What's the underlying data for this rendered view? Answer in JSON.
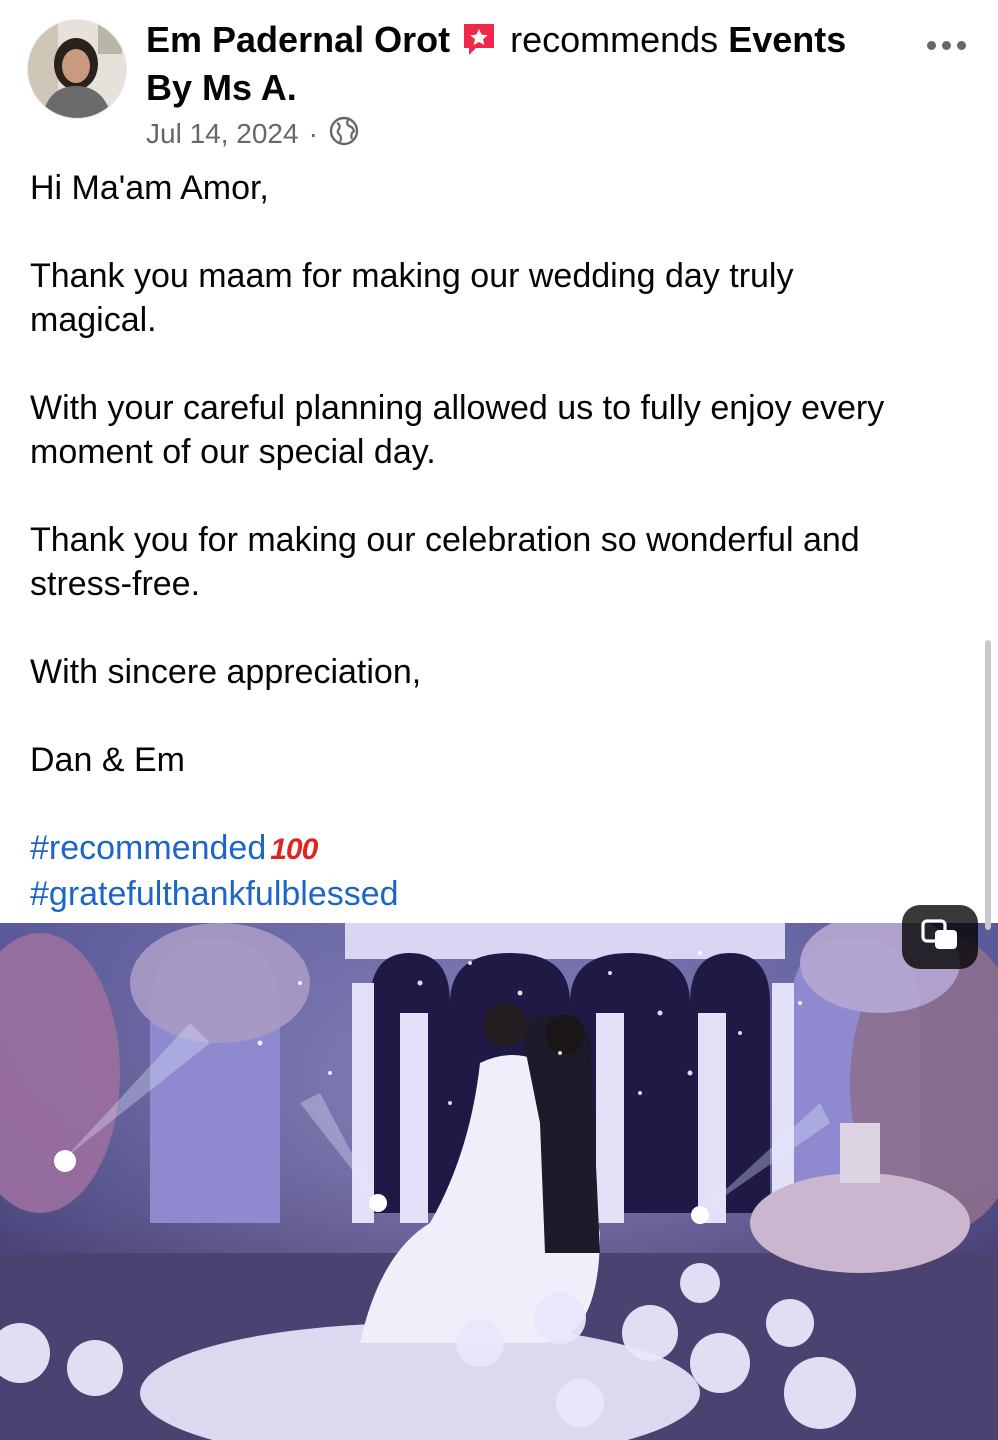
{
  "header": {
    "author_name": "Em Padernal Orot",
    "action_verb": "recommends",
    "page_name_line1": "Events",
    "page_name_line2": "By Ms A.",
    "date": "Jul 14, 2024",
    "separator": "·",
    "audience_icon": "globe-icon",
    "recommend_icon": "recommend-star-icon",
    "more_icon": "more-options-icon"
  },
  "post": {
    "greeting": "Hi Ma'am Amor,",
    "line1a": "Thank you maam for making our wedding day truly",
    "line1b": "magical.",
    "line2a": "With your careful planning allowed us to fully enjoy every",
    "line2b": "moment of our special day.",
    "line3a": "Thank you for making our celebration so wonderful and",
    "line3b": "stress-free.",
    "closing": "With sincere appreciation,",
    "signature": "Dan & Em",
    "hashtag1": "#recommended",
    "hashtag1_emoji": "100",
    "hashtag2": "#gratefulthankfulblessed"
  },
  "media": {
    "multi_media_icon": "multiple-photos-icon"
  },
  "colors": {
    "accent_link": "#1c66c7",
    "recommend_badge": "#f02849",
    "secondary_text": "#65676b"
  }
}
